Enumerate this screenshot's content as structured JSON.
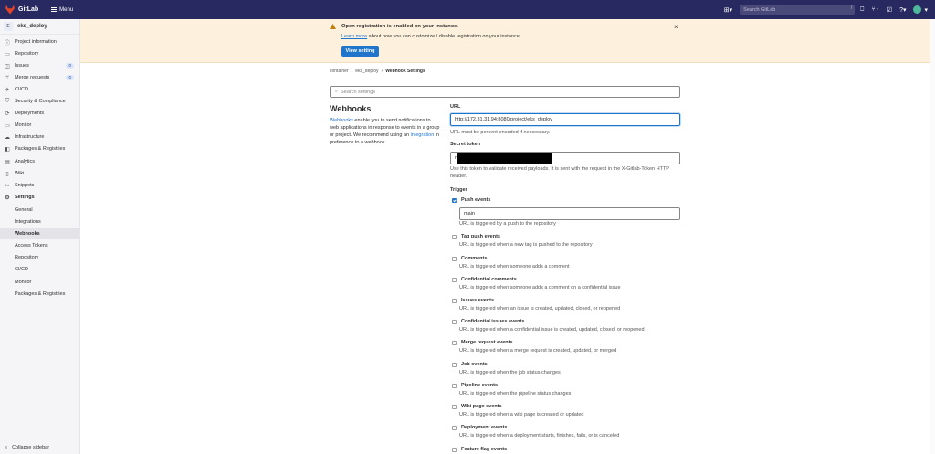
{
  "topbar": {
    "app_name": "GitLab",
    "menu_label": "Menu",
    "search_placeholder": "Search GitLab",
    "search_shortcut": "/"
  },
  "sidebar": {
    "project_initial": "E",
    "project_name": "eks_deploy",
    "items": [
      {
        "label": "Project information",
        "icon": "info-icon"
      },
      {
        "label": "Repository",
        "icon": "book-icon"
      },
      {
        "label": "Issues",
        "icon": "issues-icon",
        "badge": "0"
      },
      {
        "label": "Merge requests",
        "icon": "merge-icon",
        "badge": "0"
      },
      {
        "label": "CI/CD",
        "icon": "rocket-icon"
      },
      {
        "label": "Security & Compliance",
        "icon": "shield-icon"
      },
      {
        "label": "Deployments",
        "icon": "deploy-icon"
      },
      {
        "label": "Monitor",
        "icon": "monitor-icon"
      },
      {
        "label": "Infrastructure",
        "icon": "cloud-icon"
      },
      {
        "label": "Packages & Registries",
        "icon": "package-icon"
      },
      {
        "label": "Analytics",
        "icon": "chart-icon"
      },
      {
        "label": "Wiki",
        "icon": "wiki-icon"
      },
      {
        "label": "Snippets",
        "icon": "scissors-icon"
      },
      {
        "label": "Settings",
        "icon": "gear-icon"
      }
    ],
    "settings_sub": [
      "General",
      "Integrations",
      "Webhooks",
      "Access Tokens",
      "Repository",
      "CI/CD",
      "Monitor",
      "Packages & Registries"
    ],
    "active_sub": "Webhooks",
    "collapse_label": "Collapse sidebar"
  },
  "banner": {
    "title": "Open registration is enabled on your instance.",
    "link_text": "Learn more",
    "text": " about how you can customize / disable registration on your instance.",
    "button": "View setting"
  },
  "breadcrumb": [
    "container",
    "eks_deploy",
    "Webhook Settings"
  ],
  "search_settings_placeholder": "Search settings",
  "webhooks": {
    "title": "Webhooks",
    "desc_link1": "Webhooks",
    "desc_text1": " enable you to send notifications to web applications in response to events in a group or project. We recommend using an ",
    "desc_link2": "integration",
    "desc_text2": " in preference to a webhook.",
    "url_label": "URL",
    "url_value": "http://172.31.31.94:8080/project/eks_deploy",
    "url_help": "URL must be percent-encoded if neccessary.",
    "token_label": "Secret token",
    "token_prefix": "n",
    "token_help": "Use this token to validate received payloads. It is sent with the request in the X-Gitlab-Token HTTP header.",
    "trigger_label": "Trigger",
    "branch_value": "main",
    "triggers": [
      {
        "label": "Push events",
        "help": "URL is triggered by a push to the repository",
        "checked": true
      },
      {
        "label": "Tag push events",
        "help": "URL is triggered when a new tag is pushed to the repository",
        "checked": false
      },
      {
        "label": "Comments",
        "help": "URL is triggered when someone adds a comment",
        "checked": false
      },
      {
        "label": "Confidential comments",
        "help": "URL is triggered when someone adds a comment on a confidential issue",
        "checked": false
      },
      {
        "label": "Issues events",
        "help": "URL is triggered when an issue is created, updated, closed, or reopened",
        "checked": false
      },
      {
        "label": "Confidential issues events",
        "help": "URL is triggered when a confidential issue is created, updated, closed, or reopened",
        "checked": false
      },
      {
        "label": "Merge request events",
        "help": "URL is triggered when a merge request is created, updated, or merged",
        "checked": false
      },
      {
        "label": "Job events",
        "help": "URL is triggered when the job status changes",
        "checked": false
      },
      {
        "label": "Pipeline events",
        "help": "URL is triggered when the pipeline status changes",
        "checked": false
      },
      {
        "label": "Wiki page events",
        "help": "URL is triggered when a wiki page is created or updated",
        "checked": false
      },
      {
        "label": "Deployment events",
        "help": "URL is triggered when a deployment starts, finishes, fails, or is canceled",
        "checked": false
      },
      {
        "label": "Feature flag events",
        "help": "",
        "checked": false
      }
    ]
  }
}
